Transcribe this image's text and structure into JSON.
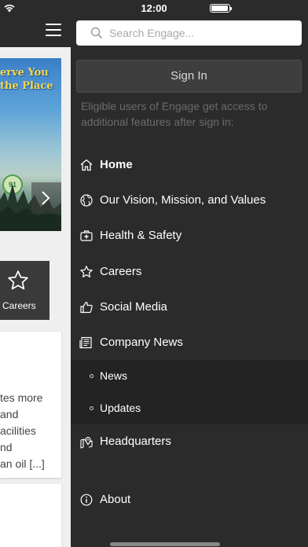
{
  "status_bar": {
    "time": "12:00"
  },
  "background_page": {
    "banner": {
      "title": "erve You\nthe Place",
      "badge": "91"
    },
    "careers_tile": {
      "label": "Careers",
      "icon": "star-icon"
    },
    "excerpt_lines": [
      "tes more",
      "and",
      "acilities",
      "nd",
      "an oil [...]"
    ]
  },
  "drawer": {
    "search": {
      "placeholder": "Search Engage...",
      "value": ""
    },
    "sign_in": "Sign In",
    "hint": "Eligible users of Engage get access to additional features after sign in:",
    "items": [
      {
        "label": "Home",
        "icon": "home-icon",
        "active": true
      },
      {
        "label": "Our Vision, Mission, and Values",
        "icon": "globe-icon"
      },
      {
        "label": "Health & Safety",
        "icon": "first-aid-icon"
      },
      {
        "label": "Careers",
        "icon": "star-icon"
      },
      {
        "label": "Social Media",
        "icon": "thumbs-up-icon"
      },
      {
        "label": "Company News",
        "icon": "newspaper-icon"
      },
      {
        "label": "Headquarters",
        "icon": "map-pin-icon"
      },
      {
        "label": "About",
        "icon": "info-icon"
      }
    ],
    "subitems": [
      {
        "label": "News"
      },
      {
        "label": "Updates"
      }
    ]
  }
}
